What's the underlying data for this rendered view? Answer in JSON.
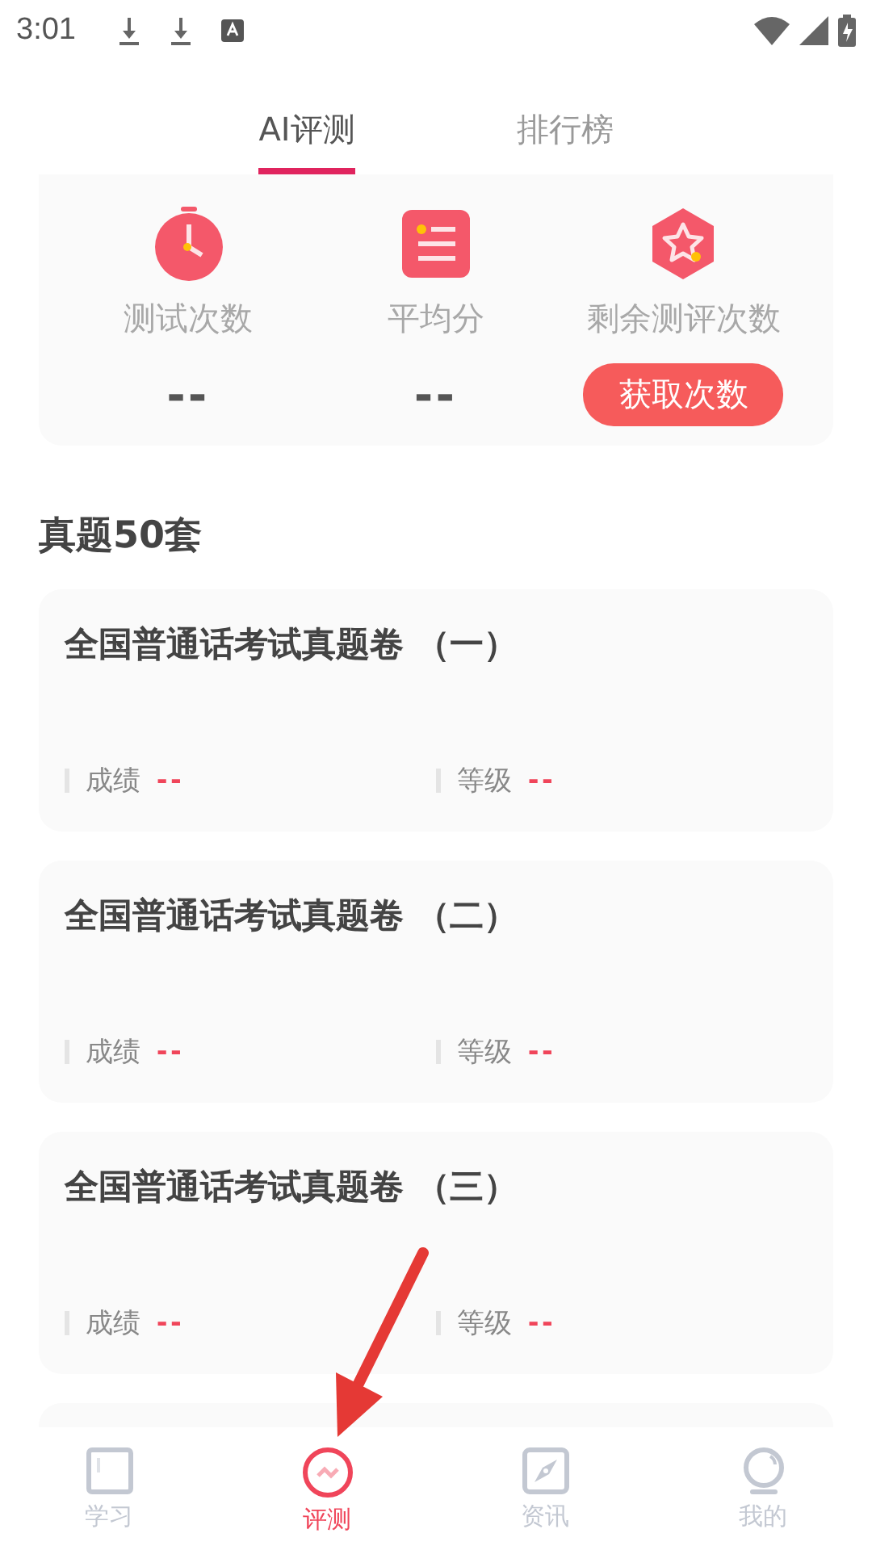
{
  "status_bar": {
    "time": "3:01"
  },
  "tabs": [
    {
      "label": "AI评测",
      "selected": true
    },
    {
      "label": "排行榜",
      "selected": false
    }
  ],
  "stats": [
    {
      "kind": "value",
      "label": "测试次数",
      "value": "--"
    },
    {
      "kind": "value",
      "label": "平均分",
      "value": "--"
    },
    {
      "kind": "action",
      "label": "剩余测评次数",
      "value": "获取次数"
    }
  ],
  "section_title": "真题50套",
  "papers": [
    {
      "title": "全国普通话考试真题卷 （一）",
      "score_label": "成绩",
      "score": "--",
      "level_label": "等级",
      "level": "--"
    },
    {
      "title": "全国普通话考试真题卷 （二）",
      "score_label": "成绩",
      "score": "--",
      "level_label": "等级",
      "level": "--"
    },
    {
      "title": "全国普通话考试真题卷 （三）",
      "score_label": "成绩",
      "score": "--",
      "level_label": "等级",
      "level": "--"
    }
  ],
  "bottom_nav": [
    {
      "label": "学习",
      "selected": false
    },
    {
      "label": "评测",
      "selected": true
    },
    {
      "label": "资讯",
      "selected": false
    },
    {
      "label": "我的",
      "selected": false
    }
  ]
}
